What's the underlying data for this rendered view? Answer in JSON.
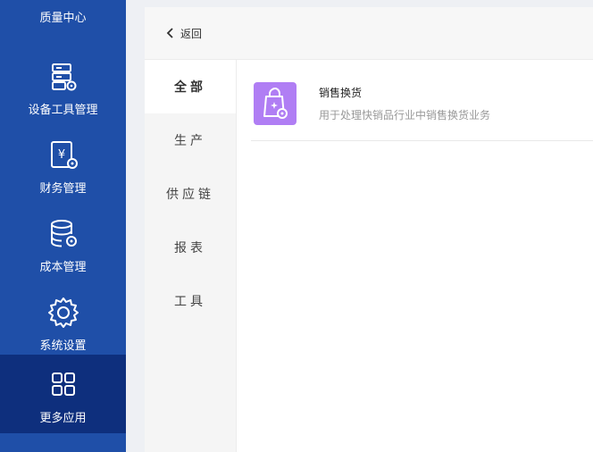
{
  "nav": {
    "top_label": "质量中心",
    "items": [
      {
        "label": "设备工具管理",
        "icon": "device-tools-icon"
      },
      {
        "label": "财务管理",
        "icon": "finance-icon"
      },
      {
        "label": "成本管理",
        "icon": "cost-database-icon"
      },
      {
        "label": "系统设置",
        "icon": "settings-gear-icon"
      },
      {
        "label": "更多应用",
        "icon": "apps-grid-icon",
        "active": true
      }
    ]
  },
  "header": {
    "back_label": "返回"
  },
  "categories": [
    {
      "label": "全部",
      "active": true
    },
    {
      "label": "生产"
    },
    {
      "label": "供应链"
    },
    {
      "label": "报表"
    },
    {
      "label": "工具"
    }
  ],
  "apps": [
    {
      "title": "销售换货",
      "description": "用于处理快销品行业中销售换货业务",
      "icon": "shopping-bag-icon",
      "icon_color": "#b07ef4"
    }
  ],
  "colors": {
    "nav_bg": "#1f4fa8",
    "nav_active_bg": "#0e2f7d"
  }
}
